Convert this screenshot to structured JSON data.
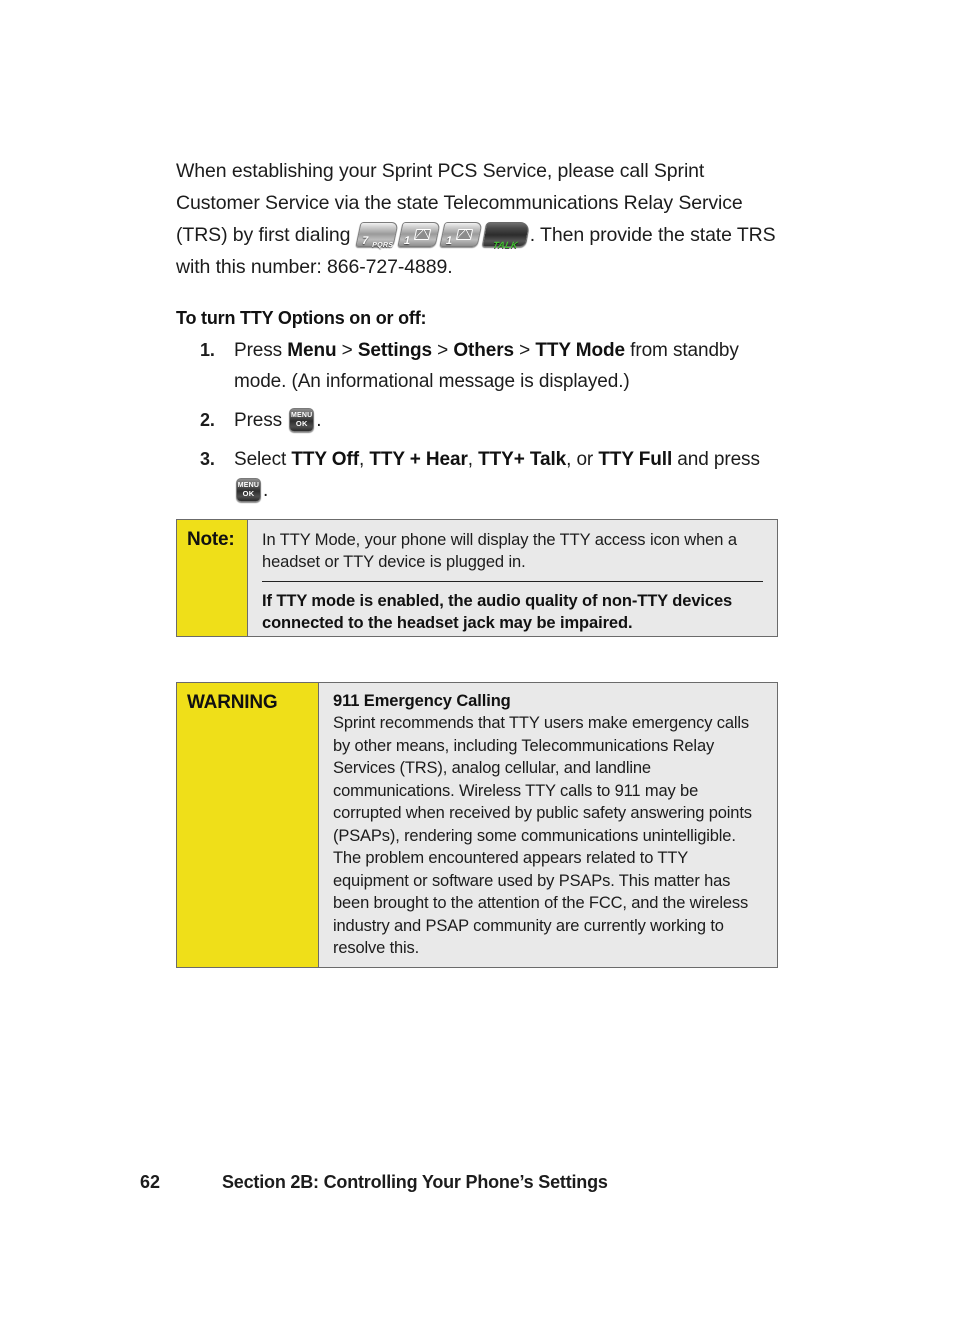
{
  "page": {
    "number": "62",
    "section_title": "Section 2B: Controlling Your Phone’s Settings"
  },
  "intro": {
    "part1": "When establishing your Sprint PCS Service, please call Sprint Customer Service via the state Telecommunications Relay Service (TRS) by first dialing ",
    "part2": ". Then provide the state TRS with this number: 866-727-4889.",
    "dial_keys": [
      {
        "name": "key-7-pqrs",
        "digit": "7",
        "sub": "PQRS",
        "type": "dialpad"
      },
      {
        "name": "key-1-voicemail",
        "digit": "1",
        "sub": "",
        "type": "dialpad-envelope"
      },
      {
        "name": "key-1-voicemail",
        "digit": "1",
        "sub": "",
        "type": "dialpad-envelope"
      },
      {
        "name": "key-talk",
        "label": "TALK",
        "type": "talk"
      }
    ]
  },
  "procedure": {
    "heading": "To turn TTY Options on or off:",
    "steps": [
      {
        "number": "1.",
        "pre": "Press ",
        "bold1": "Menu",
        "sep1": " > ",
        "bold2": "Settings",
        "sep2": " > ",
        "bold3": "Others",
        "sep3": " > ",
        "bold4": "TTY Mode",
        "post": " from standby mode. (An informational message is displayed.)"
      },
      {
        "number": "2.",
        "pre": "Press ",
        "post": "."
      },
      {
        "number": "3.",
        "pre": "Select ",
        "opt1": "TTY Off",
        "c1": ", ",
        "opt2": "TTY + Hear",
        "c2": ", ",
        "opt3": "TTY+ Talk",
        "c3": ", or ",
        "opt4": "TTY Full",
        "mid": " and press ",
        "post": "."
      }
    ]
  },
  "note_box": {
    "label": "Note:",
    "paragraph1": "In TTY Mode, your phone will display the TTY access icon when a headset or TTY device is plugged in.",
    "paragraph2": "If TTY mode is enabled, the audio quality of non-TTY devices connected to the headset jack may be impaired."
  },
  "warning_box": {
    "label": "WARNING",
    "title": "911 Emergency Calling",
    "body": "Sprint recommends that TTY users make emergency calls by other means, including Telecommunications Relay Services (TRS), analog cellular, and landline communications. Wireless TTY calls to 911 may be corrupted when received by public safety answering points (PSAPs), rendering some communications unintelligible. The problem encountered appears related to TTY equipment or software used by PSAPs. This matter has been brought to the attention of the FCC, and the wireless industry and PSAP community are currently working to resolve this."
  },
  "menu_key": {
    "line1": "MENU",
    "line2": "OK"
  },
  "colors": {
    "callout_yellow": "#EFDF19",
    "callout_gray": "#E9E9E9",
    "callout_border": "#6B6B6B",
    "talk_green": "#43C432",
    "text": "#1C1C1C"
  }
}
